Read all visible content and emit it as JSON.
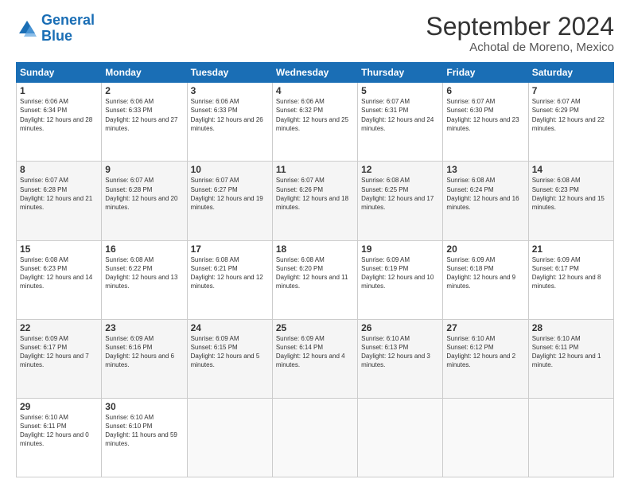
{
  "header": {
    "logo_line1": "General",
    "logo_line2": "Blue",
    "month": "September 2024",
    "location": "Achotal de Moreno, Mexico"
  },
  "weekdays": [
    "Sunday",
    "Monday",
    "Tuesday",
    "Wednesday",
    "Thursday",
    "Friday",
    "Saturday"
  ],
  "weeks": [
    [
      {
        "day": "1",
        "sunrise": "6:06 AM",
        "sunset": "6:34 PM",
        "daylight": "12 hours and 28 minutes."
      },
      {
        "day": "2",
        "sunrise": "6:06 AM",
        "sunset": "6:33 PM",
        "daylight": "12 hours and 27 minutes."
      },
      {
        "day": "3",
        "sunrise": "6:06 AM",
        "sunset": "6:33 PM",
        "daylight": "12 hours and 26 minutes."
      },
      {
        "day": "4",
        "sunrise": "6:06 AM",
        "sunset": "6:32 PM",
        "daylight": "12 hours and 25 minutes."
      },
      {
        "day": "5",
        "sunrise": "6:07 AM",
        "sunset": "6:31 PM",
        "daylight": "12 hours and 24 minutes."
      },
      {
        "day": "6",
        "sunrise": "6:07 AM",
        "sunset": "6:30 PM",
        "daylight": "12 hours and 23 minutes."
      },
      {
        "day": "7",
        "sunrise": "6:07 AM",
        "sunset": "6:29 PM",
        "daylight": "12 hours and 22 minutes."
      }
    ],
    [
      {
        "day": "8",
        "sunrise": "6:07 AM",
        "sunset": "6:28 PM",
        "daylight": "12 hours and 21 minutes."
      },
      {
        "day": "9",
        "sunrise": "6:07 AM",
        "sunset": "6:28 PM",
        "daylight": "12 hours and 20 minutes."
      },
      {
        "day": "10",
        "sunrise": "6:07 AM",
        "sunset": "6:27 PM",
        "daylight": "12 hours and 19 minutes."
      },
      {
        "day": "11",
        "sunrise": "6:07 AM",
        "sunset": "6:26 PM",
        "daylight": "12 hours and 18 minutes."
      },
      {
        "day": "12",
        "sunrise": "6:08 AM",
        "sunset": "6:25 PM",
        "daylight": "12 hours and 17 minutes."
      },
      {
        "day": "13",
        "sunrise": "6:08 AM",
        "sunset": "6:24 PM",
        "daylight": "12 hours and 16 minutes."
      },
      {
        "day": "14",
        "sunrise": "6:08 AM",
        "sunset": "6:23 PM",
        "daylight": "12 hours and 15 minutes."
      }
    ],
    [
      {
        "day": "15",
        "sunrise": "6:08 AM",
        "sunset": "6:23 PM",
        "daylight": "12 hours and 14 minutes."
      },
      {
        "day": "16",
        "sunrise": "6:08 AM",
        "sunset": "6:22 PM",
        "daylight": "12 hours and 13 minutes."
      },
      {
        "day": "17",
        "sunrise": "6:08 AM",
        "sunset": "6:21 PM",
        "daylight": "12 hours and 12 minutes."
      },
      {
        "day": "18",
        "sunrise": "6:08 AM",
        "sunset": "6:20 PM",
        "daylight": "12 hours and 11 minutes."
      },
      {
        "day": "19",
        "sunrise": "6:09 AM",
        "sunset": "6:19 PM",
        "daylight": "12 hours and 10 minutes."
      },
      {
        "day": "20",
        "sunrise": "6:09 AM",
        "sunset": "6:18 PM",
        "daylight": "12 hours and 9 minutes."
      },
      {
        "day": "21",
        "sunrise": "6:09 AM",
        "sunset": "6:17 PM",
        "daylight": "12 hours and 8 minutes."
      }
    ],
    [
      {
        "day": "22",
        "sunrise": "6:09 AM",
        "sunset": "6:17 PM",
        "daylight": "12 hours and 7 minutes."
      },
      {
        "day": "23",
        "sunrise": "6:09 AM",
        "sunset": "6:16 PM",
        "daylight": "12 hours and 6 minutes."
      },
      {
        "day": "24",
        "sunrise": "6:09 AM",
        "sunset": "6:15 PM",
        "daylight": "12 hours and 5 minutes."
      },
      {
        "day": "25",
        "sunrise": "6:09 AM",
        "sunset": "6:14 PM",
        "daylight": "12 hours and 4 minutes."
      },
      {
        "day": "26",
        "sunrise": "6:10 AM",
        "sunset": "6:13 PM",
        "daylight": "12 hours and 3 minutes."
      },
      {
        "day": "27",
        "sunrise": "6:10 AM",
        "sunset": "6:12 PM",
        "daylight": "12 hours and 2 minutes."
      },
      {
        "day": "28",
        "sunrise": "6:10 AM",
        "sunset": "6:11 PM",
        "daylight": "12 hours and 1 minute."
      }
    ],
    [
      {
        "day": "29",
        "sunrise": "6:10 AM",
        "sunset": "6:11 PM",
        "daylight": "12 hours and 0 minutes."
      },
      {
        "day": "30",
        "sunrise": "6:10 AM",
        "sunset": "6:10 PM",
        "daylight": "11 hours and 59 minutes."
      },
      null,
      null,
      null,
      null,
      null
    ]
  ]
}
